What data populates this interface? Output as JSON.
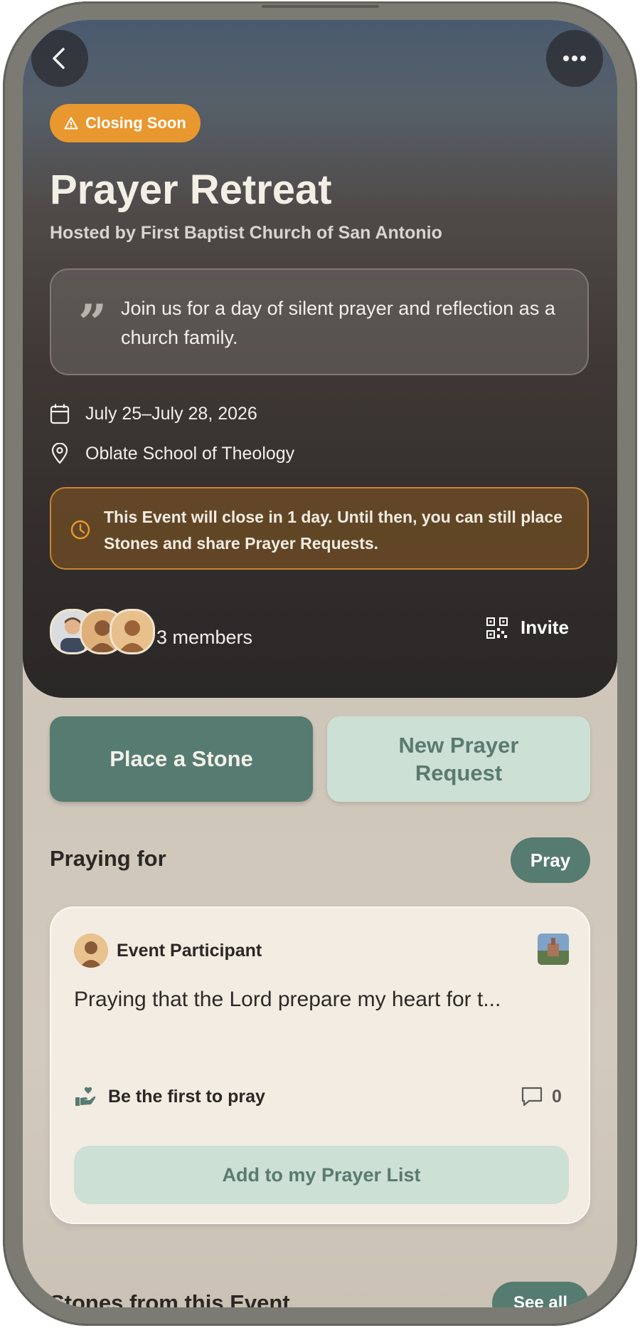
{
  "event": {
    "badge": "Closing Soon",
    "title": "Prayer Retreat",
    "host": "Hosted by First Baptist Church of San Antonio",
    "quote": "Join us for a day of silent prayer and reflection as a church family.",
    "date": "July 25–July 28, 2026",
    "location": "Oblate School of Theology",
    "closing_notice": "This Event will close in 1 day. Until then, you can still place Stones and share Prayer Requests.",
    "members_label": "3 members",
    "invite_label": "Invite"
  },
  "actions": {
    "place_stone": "Place a Stone",
    "new_request": "New Prayer Request"
  },
  "praying_for": {
    "title": "Praying for",
    "pray_label": "Pray",
    "card": {
      "author": "Event Participant",
      "text": "Praying that the Lord prepare my heart for t...",
      "pray_status": "Be the first to pray",
      "comment_count": "0",
      "add_label": "Add to my Prayer List"
    }
  },
  "stones": {
    "title": "Stones from this Event",
    "see_all": "See all"
  },
  "colors": {
    "accent_green": "#567b70",
    "light_green": "#cde0d5",
    "warning_orange": "#e8982f"
  }
}
